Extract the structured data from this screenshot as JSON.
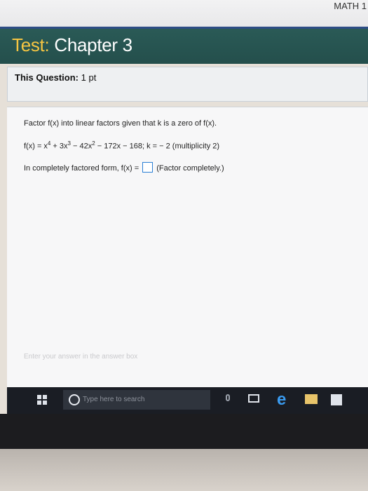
{
  "course_code": "MATH 1",
  "test": {
    "word1": "Test:",
    "word2": "Chapter 3"
  },
  "question": {
    "label": "This Question:",
    "points": "1 pt"
  },
  "problem": {
    "instruction": "Factor f(x) into linear factors given that k is a zero of f(x).",
    "function_prefix": "f(x) = x",
    "exp4": "4",
    "term2": " + 3x",
    "exp3": "3",
    "term3": " − 42x",
    "exp2": "2",
    "tail": " − 172x − 168; k = − 2 (multiplicity 2)",
    "answer_prefix": "In completely factored form, f(x) =",
    "answer_suffix": "(Factor completely.)"
  },
  "hint": "Enter your answer in the answer box",
  "taskbar": {
    "search_placeholder": "Type here to search",
    "icons": [
      "windows-icon",
      "search-icon",
      "microphone-icon",
      "task-view-icon",
      "edge-icon",
      "folder-icon",
      "store-icon"
    ]
  },
  "colors": {
    "header": "#2a5a56",
    "title_accent": "#f5c542",
    "answer_box_border": "#2a7fd4",
    "taskbar": "#1a1d24"
  }
}
